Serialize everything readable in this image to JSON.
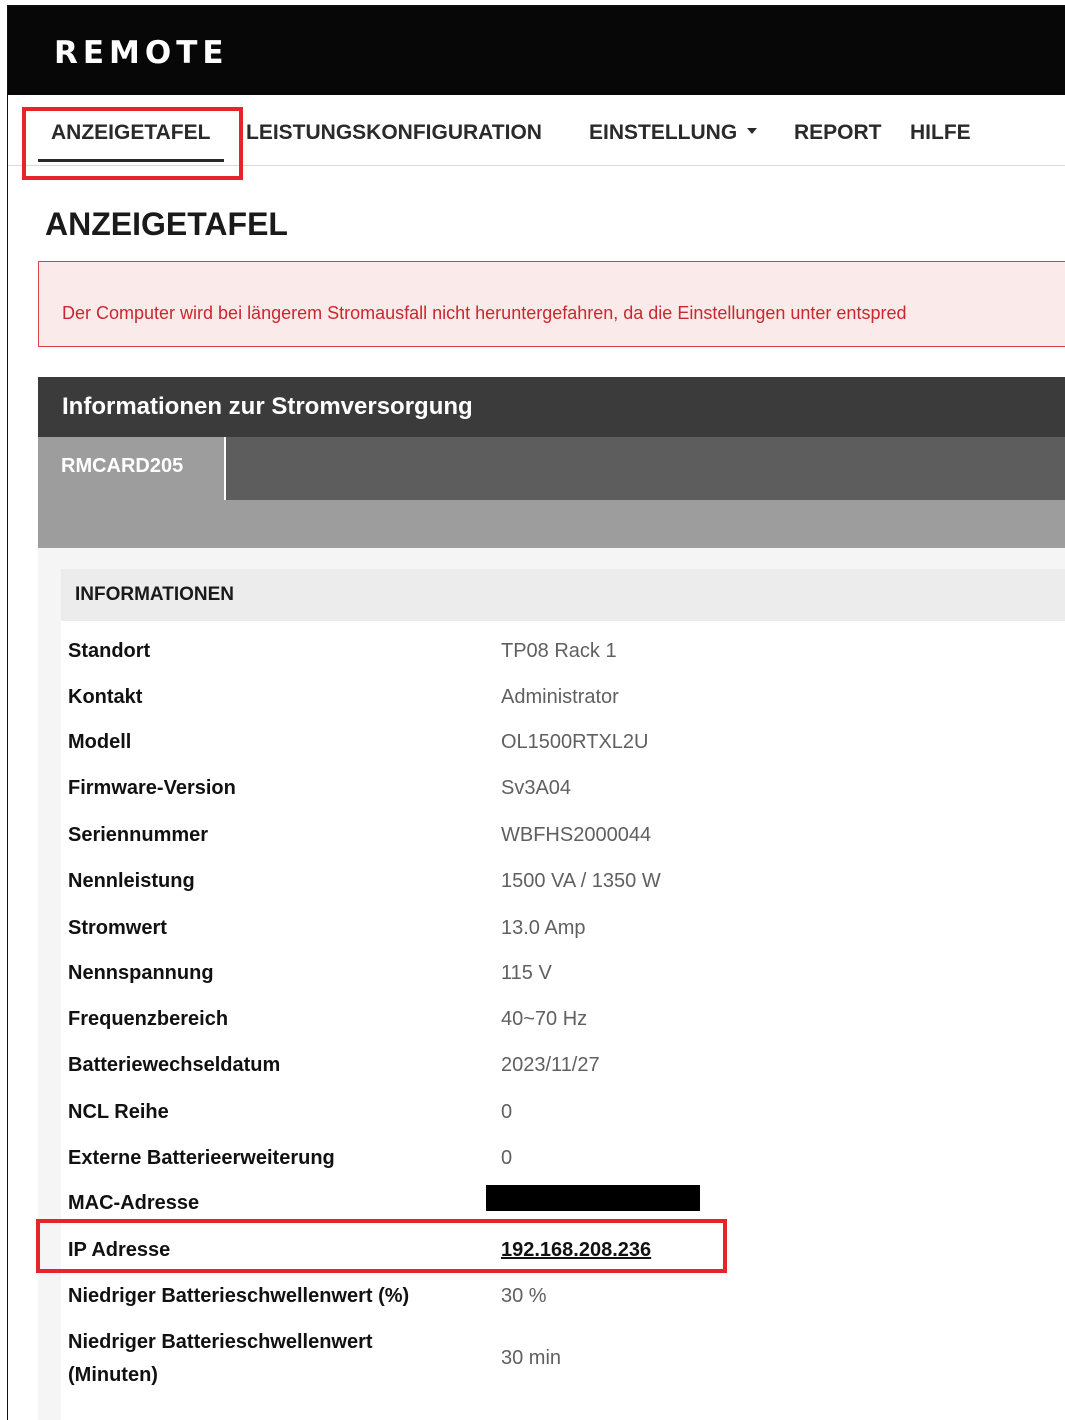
{
  "brand": "REMOTE",
  "nav": {
    "items": [
      {
        "label": "ANZEIGETAFEL",
        "active": true
      },
      {
        "label": "LEISTUNGSKONFIGURATION"
      },
      {
        "label": "EINSTELLUNG",
        "dropdown": true
      },
      {
        "label": "REPORT"
      },
      {
        "label": "HILFE"
      }
    ]
  },
  "page_title": "ANZEIGETAFEL",
  "alert": "Der Computer wird bei längerem Stromausfall nicht heruntergefahren, da die Einstellungen unter entspred",
  "panel": {
    "title": "Informationen zur Stromversorgung",
    "tab": "RMCARD205"
  },
  "info": {
    "heading": "INFORMATIONEN",
    "rows": [
      {
        "label": "Standort",
        "value": "TP08 Rack 1"
      },
      {
        "label": "Kontakt",
        "value": "Administrator"
      },
      {
        "label": "Modell",
        "value": "OL1500RTXL2U"
      },
      {
        "label": "Firmware-Version",
        "value": "Sv3A04"
      },
      {
        "label": "Seriennummer",
        "value": "WBFHS2000044"
      },
      {
        "label": "Nennleistung",
        "value": "1500 VA / 1350 W"
      },
      {
        "label": "Stromwert",
        "value": "13.0 Amp"
      },
      {
        "label": "Nennspannung",
        "value": "115 V"
      },
      {
        "label": "Frequenzbereich",
        "value": "40~70 Hz"
      },
      {
        "label": "Batteriewechseldatum",
        "value": "2023/11/27"
      },
      {
        "label": "NCL Reihe",
        "value": "0"
      },
      {
        "label": "Externe Batterieerweiterung",
        "value": "0"
      },
      {
        "label": "MAC-Adresse",
        "value": ""
      },
      {
        "label": "IP Adresse",
        "value": "192.168.208.236"
      },
      {
        "label": "Niedriger Batterieschwellenwert (%)",
        "value": "30 %"
      },
      {
        "label_line1": "Niedriger Batterieschwellenwert",
        "label_line2": "(Minuten)",
        "value": "30 min"
      }
    ]
  },
  "colors": {
    "highlight": "#e5242b",
    "header_bg": "#070707",
    "panel_head": "#3b3b3b",
    "alert_text": "#c8282f"
  }
}
